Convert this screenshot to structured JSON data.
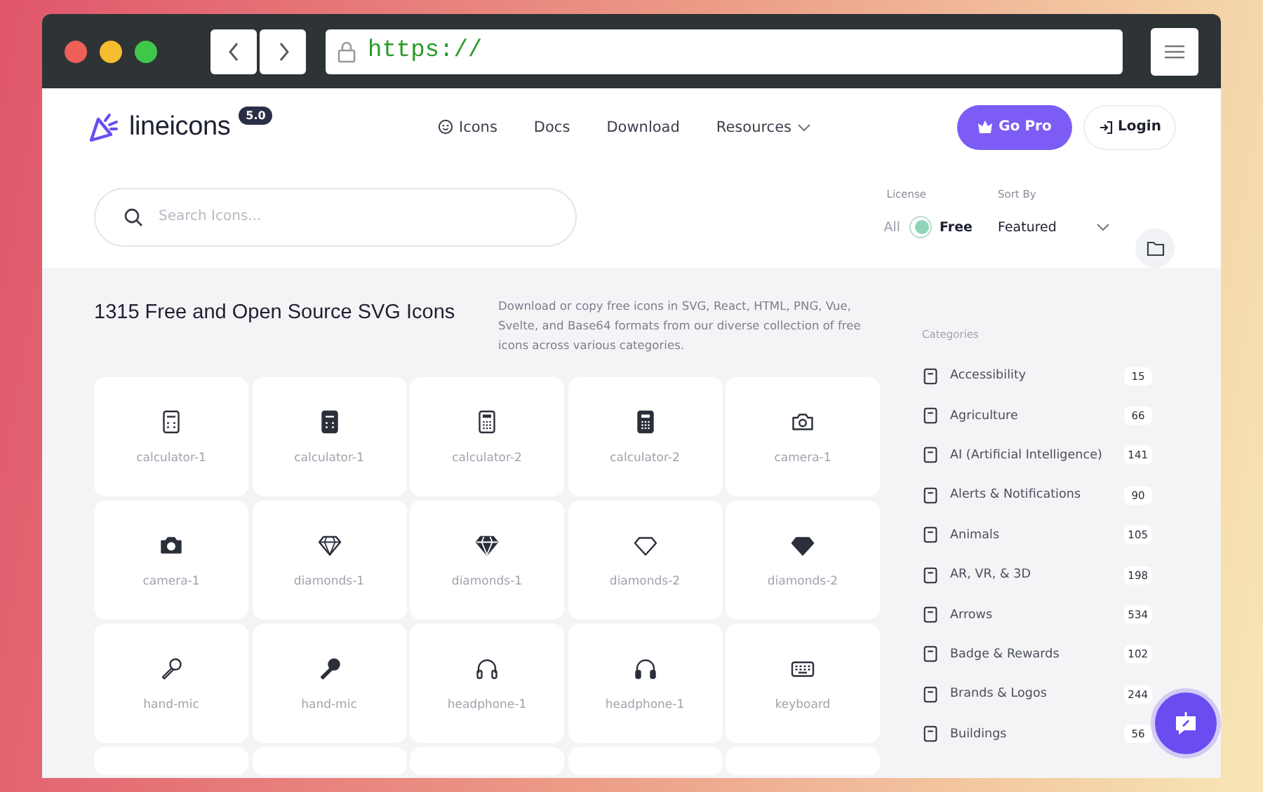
{
  "browser": {
    "url": "https://"
  },
  "nav": {
    "logo": "lineicons",
    "version": "5.0",
    "links": [
      {
        "label": "Icons",
        "icon": true,
        "dropdown": false
      },
      {
        "label": "Docs",
        "icon": false,
        "dropdown": false
      },
      {
        "label": "Download",
        "icon": false,
        "dropdown": false
      },
      {
        "label": "Resources",
        "icon": false,
        "dropdown": true
      }
    ],
    "pro_button": "Go Pro",
    "login_button": "Login"
  },
  "search": {
    "placeholder": "Search Icons..."
  },
  "license": {
    "label": "License",
    "options": [
      "All",
      "Free"
    ],
    "free_only": true
  },
  "sort": {
    "label": "Sort By",
    "value": "Featured"
  },
  "heading": "1315 Free and Open Source SVG Icons",
  "description": "Download or copy free icons in SVG, React, HTML, PNG, Vue, Svelte, and Base64 formats from our diverse collection of free icons across various categories.",
  "icons": [
    {
      "label": "calculator-1",
      "kind": "calculator",
      "solid": false
    },
    {
      "label": "calculator-1",
      "kind": "calculator",
      "solid": true
    },
    {
      "label": "calculator-2",
      "kind": "keypad",
      "solid": false
    },
    {
      "label": "calculator-2",
      "kind": "keypad",
      "solid": true
    },
    {
      "label": "camera-1",
      "kind": "camera",
      "solid": false
    },
    {
      "label": "camera-1",
      "kind": "camera",
      "solid": true
    },
    {
      "label": "diamonds-1",
      "kind": "diamond",
      "solid": false
    },
    {
      "label": "diamonds-1",
      "kind": "diamond",
      "solid": true
    },
    {
      "label": "diamonds-2",
      "kind": "gem",
      "solid": false
    },
    {
      "label": "diamonds-2",
      "kind": "gem",
      "solid": true
    },
    {
      "label": "hand-mic",
      "kind": "mic",
      "solid": false
    },
    {
      "label": "hand-mic",
      "kind": "mic",
      "solid": true
    },
    {
      "label": "headphone-1",
      "kind": "headphone",
      "solid": false
    },
    {
      "label": "headphone-1",
      "kind": "headphone",
      "solid": true
    },
    {
      "label": "keyboard",
      "kind": "keyboard",
      "solid": false
    }
  ],
  "categories": {
    "title": "Categories",
    "items": [
      {
        "name": "Accessibility",
        "count": "15"
      },
      {
        "name": "Agriculture",
        "count": "66"
      },
      {
        "name": "AI (Artificial Intelligence)",
        "count": "141"
      },
      {
        "name": "Alerts & Notifications",
        "count": "90"
      },
      {
        "name": "Animals",
        "count": "105"
      },
      {
        "name": "AR, VR, & 3D",
        "count": "198"
      },
      {
        "name": "Arrows",
        "count": "534"
      },
      {
        "name": "Badge & Rewards",
        "count": "102"
      },
      {
        "name": "Brands & Logos",
        "count": "244"
      },
      {
        "name": "Buildings",
        "count": "56"
      }
    ]
  }
}
